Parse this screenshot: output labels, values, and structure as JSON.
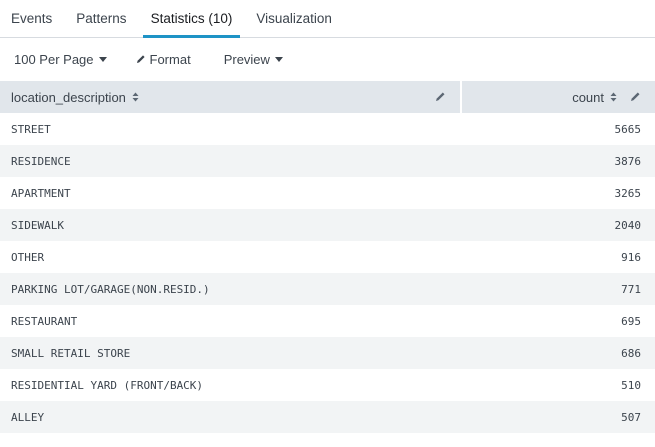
{
  "tabs": [
    {
      "label": "Events",
      "active": false
    },
    {
      "label": "Patterns",
      "active": false
    },
    {
      "label": "Statistics (10)",
      "active": true
    },
    {
      "label": "Visualization",
      "active": false
    }
  ],
  "toolbar": {
    "per_page_label": "100 Per Page",
    "format_label": "Format",
    "preview_label": "Preview"
  },
  "table": {
    "columns": [
      {
        "label": "location_description",
        "icon": "sort-icon"
      },
      {
        "label": "count",
        "icon": "sort-icon"
      }
    ],
    "rows": [
      {
        "location_description": "STREET",
        "count": "5665"
      },
      {
        "location_description": "RESIDENCE",
        "count": "3876"
      },
      {
        "location_description": "APARTMENT",
        "count": "3265"
      },
      {
        "location_description": "SIDEWALK",
        "count": "2040"
      },
      {
        "location_description": "OTHER",
        "count": "916"
      },
      {
        "location_description": "PARKING LOT/GARAGE(NON.RESID.)",
        "count": "771"
      },
      {
        "location_description": "RESTAURANT",
        "count": "695"
      },
      {
        "location_description": "SMALL RETAIL STORE",
        "count": "686"
      },
      {
        "location_description": "RESIDENTIAL YARD (FRONT/BACK)",
        "count": "510"
      },
      {
        "location_description": "ALLEY",
        "count": "507"
      }
    ]
  },
  "colors": {
    "accent": "#1e93c6",
    "header_bg": "#e1e6eb",
    "stripe_bg": "#f2f4f5",
    "text": "#3c444d"
  }
}
